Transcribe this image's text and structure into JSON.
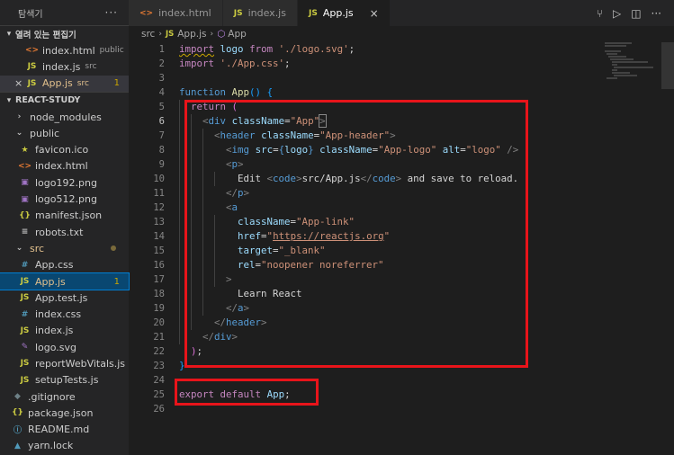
{
  "sidebar": {
    "title": "탐색기",
    "more": "···",
    "open_editors": {
      "label": "열려 있는 편집기",
      "items": [
        {
          "icon": "<>",
          "name": "index.html",
          "sub": "public"
        },
        {
          "icon": "JS",
          "name": "index.js",
          "sub": "src"
        },
        {
          "icon": "JS",
          "name": "App.js",
          "sub": "src",
          "close": "×",
          "badge": "1"
        }
      ]
    },
    "project": {
      "label": "REACT-STUDY",
      "node_modules": "node_modules",
      "public": {
        "label": "public",
        "items": [
          "favicon.ico",
          "index.html",
          "logo192.png",
          "logo512.png",
          "manifest.json",
          "robots.txt"
        ]
      },
      "src": {
        "label": "src",
        "items": [
          "App.css",
          "App.js",
          "App.test.js",
          "index.css",
          "index.js",
          "logo.svg",
          "reportWebVitals.js",
          "setupTests.js"
        ],
        "app_badge": "1"
      },
      "root_items": [
        ".gitignore",
        "package.json",
        "README.md",
        "yarn.lock"
      ]
    }
  },
  "tabs": [
    {
      "icon": "<>",
      "label": "index.html"
    },
    {
      "icon": "JS",
      "label": "index.js"
    },
    {
      "icon": "JS",
      "label": "App.js",
      "close": "×"
    }
  ],
  "tab_actions": [
    "source-control-icon",
    "run-icon",
    "split-editor-icon",
    "more-icon"
  ],
  "breadcrumb": {
    "folder": "src",
    "file_icon": "JS",
    "file": "App.js",
    "symbol": "App"
  },
  "editor": {
    "line_numbers": [
      "1",
      "2",
      "3",
      "4",
      "5",
      "6",
      "7",
      "8",
      "9",
      "10",
      "11",
      "12",
      "13",
      "14",
      "15",
      "16",
      "17",
      "18",
      "19",
      "20",
      "21",
      "22",
      "23",
      "24",
      "25",
      "26"
    ],
    "current_line": "6",
    "code": {
      "l1_kw": "import",
      "l1_id": "logo",
      "l1_from": "from",
      "l1_str": "'./logo.svg'",
      "l2_kw": "import",
      "l2_str": "'./App.css'",
      "l4_kw": "function",
      "l4_fn": "App",
      "l5_kw": "return",
      "l6_tag": "div",
      "l6_attr": "className",
      "l6_val": "\"App\"",
      "l7_tag": "header",
      "l7_attr": "className",
      "l7_val": "\"App-header\"",
      "l8_tag": "img",
      "l8_attr1": "src",
      "l8_expr": "logo",
      "l8_attr2": "className",
      "l8_val2": "\"App-logo\"",
      "l8_attr3": "alt",
      "l8_val3": "\"logo\"",
      "l9_tag": "p",
      "l10_text1": "Edit ",
      "l10_code": "code",
      "l10_path": "src/App.js",
      "l10_text2": " and save to reload.",
      "l11_tag": "p",
      "l12_tag": "a",
      "l13_attr": "className",
      "l13_val": "\"App-link\"",
      "l14_attr": "href",
      "l14_val_q1": "\"",
      "l14_url": "https://reactjs.org",
      "l14_val_q2": "\"",
      "l15_attr": "target",
      "l15_val": "\"_blank\"",
      "l16_attr": "rel",
      "l16_val": "\"noopener noreferrer\"",
      "l18_text": "Learn React",
      "l19_tag": "a",
      "l20_tag": "header",
      "l21_tag": "div",
      "l25_kw1": "export",
      "l25_kw2": "default",
      "l25_id": "App"
    }
  }
}
